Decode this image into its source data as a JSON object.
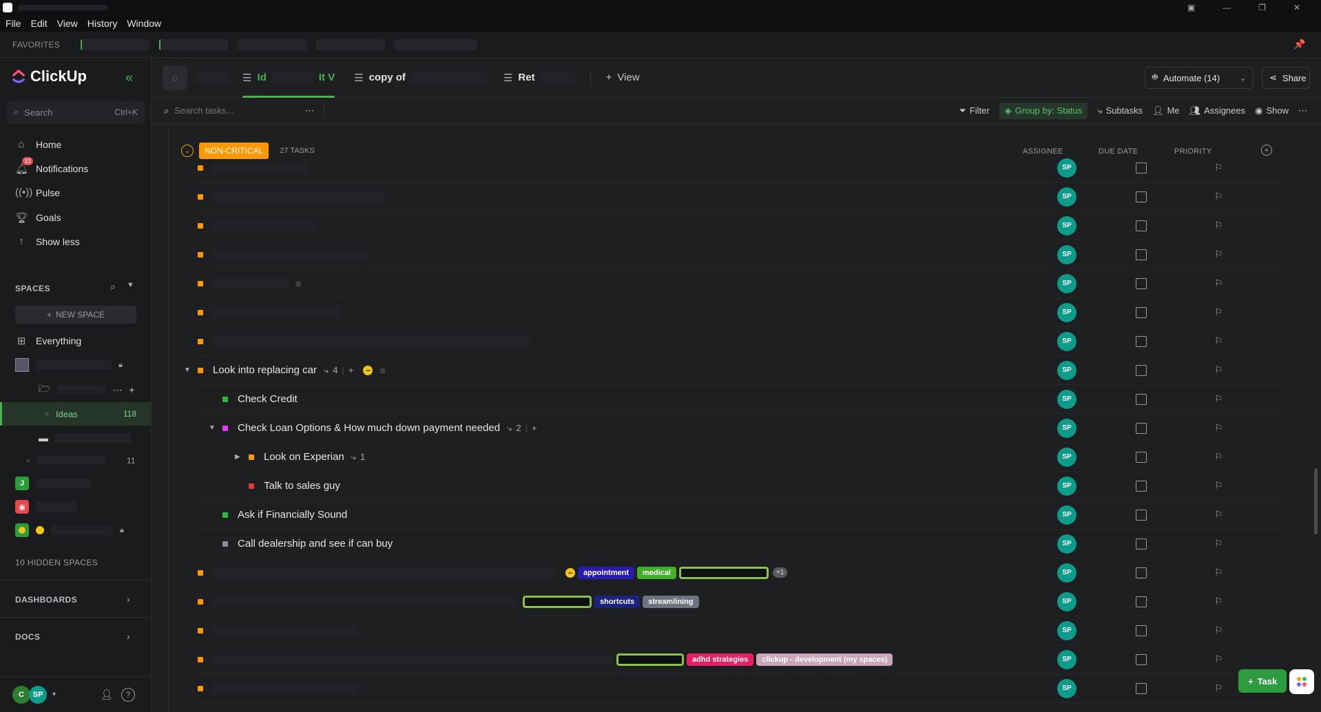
{
  "menu": [
    "File",
    "Edit",
    "View",
    "History",
    "Window"
  ],
  "favorites_label": "FAVORITES",
  "brand": "ClickUp",
  "search": {
    "placeholder": "Search",
    "shortcut": "Ctrl+K"
  },
  "nav": [
    {
      "label": "Home",
      "icon": "home-icon"
    },
    {
      "label": "Notifications",
      "icon": "bell-icon",
      "badge": "33"
    },
    {
      "label": "Pulse",
      "icon": "pulse-icon"
    },
    {
      "label": "Goals",
      "icon": "trophy-icon"
    },
    {
      "label": "Show less",
      "icon": "arrow-up-icon"
    }
  ],
  "spaces_label": "SPACES",
  "new_space": "NEW SPACE",
  "everything": "Everything",
  "ideas": {
    "label": "Ideas",
    "count": "118"
  },
  "other_count": "11",
  "space_initial": "J",
  "hidden_spaces": "10 HIDDEN SPACES",
  "dashboards": "DASHBOARDS",
  "docs": "DOCS",
  "user_initials": [
    "C",
    "SP"
  ],
  "tabs": [
    {
      "label": "Id",
      "suffix": "It V"
    },
    {
      "label": "copy of"
    },
    {
      "label": "Ret"
    },
    {
      "label": "View"
    }
  ],
  "automate": "Automate (14)",
  "share": "Share",
  "task_search_placeholder": "Search tasks...",
  "filters": {
    "filter": "Filter",
    "group": "Group by: Status",
    "subtasks": "Subtasks",
    "me": "Me",
    "assignees": "Assignees",
    "show": "Show"
  },
  "group": {
    "status": "NON-CRITICAL",
    "count": "27 TASKS"
  },
  "columns": {
    "assignee": "ASSIGNEE",
    "due": "DUE DATE",
    "priority": "PRIORITY"
  },
  "assignee_initials": "SP",
  "tasks": {
    "car": {
      "name": "Look into replacing car",
      "subtasks": "4"
    },
    "credit": {
      "name": "Check Credit"
    },
    "loan": {
      "name": "Check Loan Options & How much down payment needed",
      "subtasks": "2"
    },
    "experian": {
      "name": "Look on Experian",
      "subtasks": "1"
    },
    "sales": {
      "name": "Talk to sales guy"
    },
    "financially": {
      "name": "Ask if Financially Sound"
    },
    "dealership": {
      "name": "Call dealership and see if can buy"
    }
  },
  "tags": {
    "appointment": "appointment",
    "medical": "medical",
    "more": "+1",
    "shortcuts": "shortcuts",
    "streamlining": "streamlining",
    "adhd": "adhd strategies",
    "clickup": "clickup - development (my spaces)"
  },
  "add_task": "Task",
  "colors": {
    "accent": "#4caf50",
    "noncritical": "#ff9800",
    "avatar": "#0e9b8a"
  }
}
